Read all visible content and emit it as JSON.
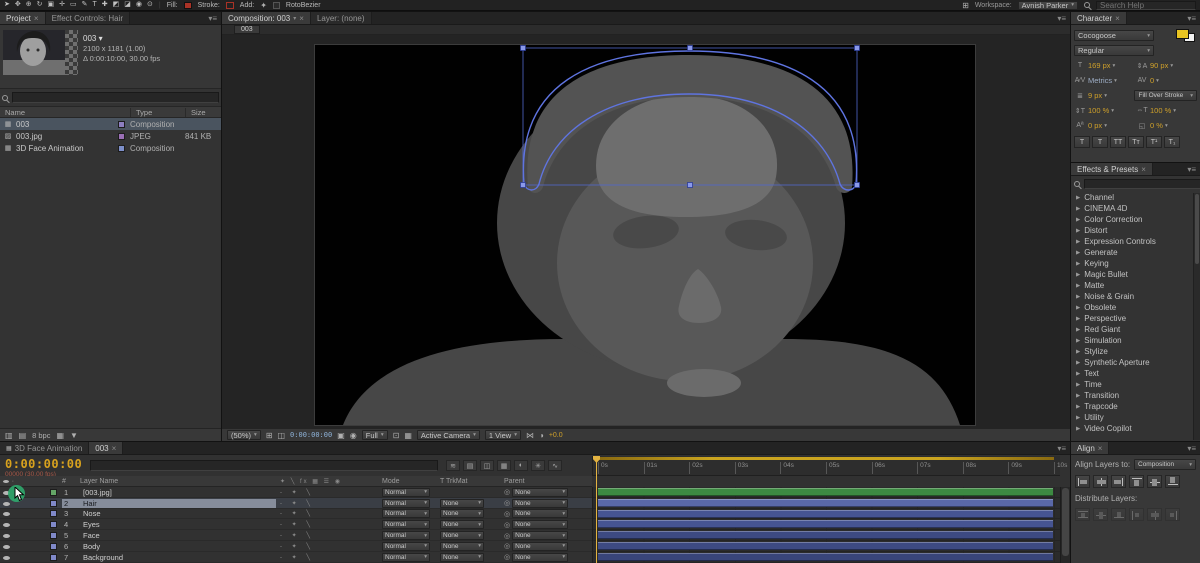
{
  "colors": {
    "timecode_yellow": "#d8a21e",
    "frames_info_red": "#a85848",
    "viewer_timecode": "#8fb3d9",
    "cti": "#e3b341",
    "selection_blue": "#5f74e0"
  },
  "topbar": {
    "tools": [
      {
        "name": "tool-selection",
        "glyph": "➤"
      },
      {
        "name": "tool-hand",
        "glyph": "✥"
      },
      {
        "name": "tool-zoom",
        "glyph": "⊕"
      },
      {
        "name": "tool-rotate",
        "glyph": "↻"
      },
      {
        "name": "tool-camera",
        "glyph": "▣"
      },
      {
        "name": "tool-pan-behind",
        "glyph": "✛"
      },
      {
        "name": "tool-mask",
        "glyph": "▭"
      },
      {
        "name": "tool-pen",
        "glyph": "✎"
      },
      {
        "name": "tool-type",
        "glyph": "T"
      },
      {
        "name": "tool-brush",
        "glyph": "✚"
      },
      {
        "name": "tool-clone-stamp",
        "glyph": "◩"
      },
      {
        "name": "tool-eraser",
        "glyph": "◪"
      },
      {
        "name": "tool-roto-brush",
        "glyph": "◉"
      },
      {
        "name": "tool-puppet",
        "glyph": "⊙"
      }
    ],
    "fill_label": "Fill:",
    "fill_color": "#a93226",
    "stroke_label": "Stroke:",
    "stroke_color": "#a93226",
    "add_label": "Add:",
    "rotobezier_label": "RotoBezier",
    "workspace_label": "Workspace:",
    "workspace_value": "Avnish Parker",
    "search_placeholder": "Search Help"
  },
  "project": {
    "tab_project": "Project",
    "tab_effect_controls": "Effect Controls: Hair",
    "comp_name": "003",
    "comp_dimensions": "2100 x 1181 (1.00)",
    "comp_duration": "Δ 0:00:10:00, 30.00 fps",
    "columns": {
      "name": "Name",
      "type": "Type",
      "size": "Size"
    },
    "items": [
      {
        "name": "003",
        "icon": "▦",
        "chip": "#8d7fc0",
        "type": "Composition",
        "size": "",
        "selected": true
      },
      {
        "name": "003.jpg",
        "icon": "▨",
        "chip": "#9a6fb5",
        "type": "JPEG",
        "size": "841 KB",
        "selected": false
      },
      {
        "name": "3D Face Animation",
        "icon": "▦",
        "chip": "#7d8fc9",
        "type": "Composition",
        "size": "",
        "selected": false
      }
    ],
    "bpc_label": "8 bpc"
  },
  "viewer": {
    "tab_composition": "Composition: 003",
    "tab_layer": "Layer: (none)",
    "mini_tab": "003",
    "zoom": "(50%)",
    "timecode": "0:00:00:00",
    "resolution": "Full",
    "camera": "Active Camera",
    "view_layout": "1 View",
    "exposure": "+0.0"
  },
  "character": {
    "title": "Character",
    "font_family": "Cocogoose",
    "font_style": "Regular",
    "fill_color": "#e8c421",
    "font_size": "169 px",
    "leading": "90 px",
    "kerning": "Metrics",
    "tracking": "0",
    "stroke_width": "9 px",
    "stroke_style": "Fill Over Stroke",
    "vertical_scale": "100 %",
    "horizontal_scale": "100 %",
    "baseline_shift": "0 px",
    "tsume": "0 %",
    "faux": [
      "T",
      "T",
      "TT",
      "Tт",
      "T¹",
      "T₁"
    ]
  },
  "effects": {
    "title": "Effects & Presets",
    "categories": [
      "Channel",
      "CINEMA 4D",
      "Color Correction",
      "Distort",
      "Expression Controls",
      "Generate",
      "Keying",
      "Magic Bullet",
      "Matte",
      "Noise & Grain",
      "Obsolete",
      "Perspective",
      "Red Giant",
      "Simulation",
      "Stylize",
      "Synthetic Aperture",
      "Text",
      "Time",
      "Transition",
      "Trapcode",
      "Utility",
      "Video Copilot"
    ]
  },
  "align": {
    "title": "Align",
    "align_layers_label": "Align Layers to:",
    "align_layers_value": "Composition",
    "distribute_label": "Distribute Layers:"
  },
  "timeline": {
    "tab_other": "3D Face Animation",
    "tab_active": "003",
    "timecode": "0:00:00:00",
    "frames_info": "00000 (30.00 fps)",
    "columns": {
      "num": "#",
      "layer_name": "Layer Name",
      "mode": "Mode",
      "trkmat": "T TrkMat",
      "parent": "Parent"
    },
    "switch_icons": "✦ ╲ fx ▦ ☰ ◉",
    "ruler_ticks": [
      "0s",
      "01s",
      "02s",
      "03s",
      "04s",
      "05s",
      "06s",
      "07s",
      "08s",
      "09s",
      "10s"
    ],
    "layers": [
      {
        "num": "1",
        "name": "[003.jpg]",
        "mode": "Normal",
        "trkmat": "",
        "parent": "None",
        "chip": "#64a567",
        "bar": "#3d8a42",
        "selected": false
      },
      {
        "num": "2",
        "name": "Hair",
        "mode": "Normal",
        "trkmat": "None",
        "parent": "None",
        "chip": "#8089c9",
        "bar": "#5a68a8",
        "selected": true
      },
      {
        "num": "3",
        "name": "Nose",
        "mode": "Normal",
        "trkmat": "None",
        "parent": "None",
        "chip": "#8089c9",
        "bar": "#465492",
        "selected": false
      },
      {
        "num": "4",
        "name": "Eyes",
        "mode": "Normal",
        "trkmat": "None",
        "parent": "None",
        "chip": "#8089c9",
        "bar": "#465492",
        "selected": false
      },
      {
        "num": "5",
        "name": "Face",
        "mode": "Normal",
        "trkmat": "None",
        "parent": "None",
        "chip": "#8089c9",
        "bar": "#3d4a82",
        "selected": false
      },
      {
        "num": "6",
        "name": "Body",
        "mode": "Normal",
        "trkmat": "None",
        "parent": "None",
        "chip": "#8089c9",
        "bar": "#3d4a82",
        "selected": false
      },
      {
        "num": "7",
        "name": "Background",
        "mode": "Normal",
        "trkmat": "None",
        "parent": "None",
        "chip": "#8089c9",
        "bar": "#39457a",
        "selected": false
      }
    ]
  }
}
